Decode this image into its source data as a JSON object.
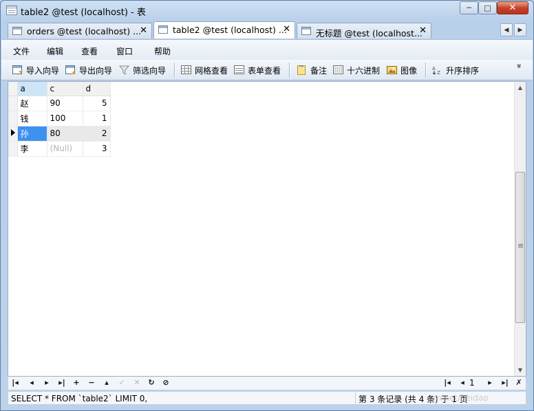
{
  "window": {
    "title": "table2 @test (localhost) - 表",
    "controls": {
      "minimize": "─",
      "maximize": "□",
      "close": "✕"
    }
  },
  "tabs": [
    {
      "label": "orders @test (localhost) ...",
      "close": "✕",
      "active": false
    },
    {
      "label": "table2 @test (localhost) ...",
      "close": "✕",
      "active": true
    },
    {
      "label": "无标题 @test (localhost...",
      "close": "✕",
      "active": false
    }
  ],
  "tab_scroll": {
    "left": "◀",
    "right": "▶"
  },
  "menu": [
    "文件",
    "编辑",
    "查看",
    "窗口",
    "帮助"
  ],
  "toolbar": {
    "items": [
      {
        "label": "导入向导",
        "icon": "import-wizard-icon"
      },
      {
        "label": "导出向导",
        "icon": "export-wizard-icon"
      },
      {
        "label": "筛选向导",
        "icon": "filter-wizard-icon"
      },
      {
        "label": "网格查看",
        "icon": "grid-view-icon"
      },
      {
        "label": "表单查看",
        "icon": "form-view-icon"
      },
      {
        "label": "备注",
        "icon": "memo-icon"
      },
      {
        "label": "十六进制",
        "icon": "hex-icon"
      },
      {
        "label": "图像",
        "icon": "image-icon"
      },
      {
        "label": "升序排序",
        "icon": "sort-ascending-icon"
      }
    ],
    "overflow": "»"
  },
  "grid": {
    "columns": [
      "a",
      "c",
      "d"
    ],
    "rows": [
      {
        "a": "赵",
        "c": "90",
        "d": "5"
      },
      {
        "a": "钱",
        "c": "100",
        "d": "1"
      },
      {
        "a": "孙",
        "c": "80",
        "d": "2"
      },
      {
        "a": "李",
        "c": "(Null)",
        "d": "3"
      }
    ],
    "current_row": 2
  },
  "navigation": {
    "buttons": [
      "first",
      "prev",
      "next",
      "last",
      "add",
      "delete",
      "post",
      "cancel",
      "clear",
      "refresh",
      "stop"
    ],
    "page": "1"
  },
  "status": {
    "sql": "SELECT * FROM `table2` LIMIT 0,",
    "record_info": "第 3 条记录 (共 4 条) 于 1 页"
  },
  "watermark": "rn.net/beidao",
  "colors": {
    "selection": "#3d92f0",
    "header_selected": "#cde6f7",
    "null_text": "#b5b5b5",
    "close_button": "#c7432a"
  }
}
